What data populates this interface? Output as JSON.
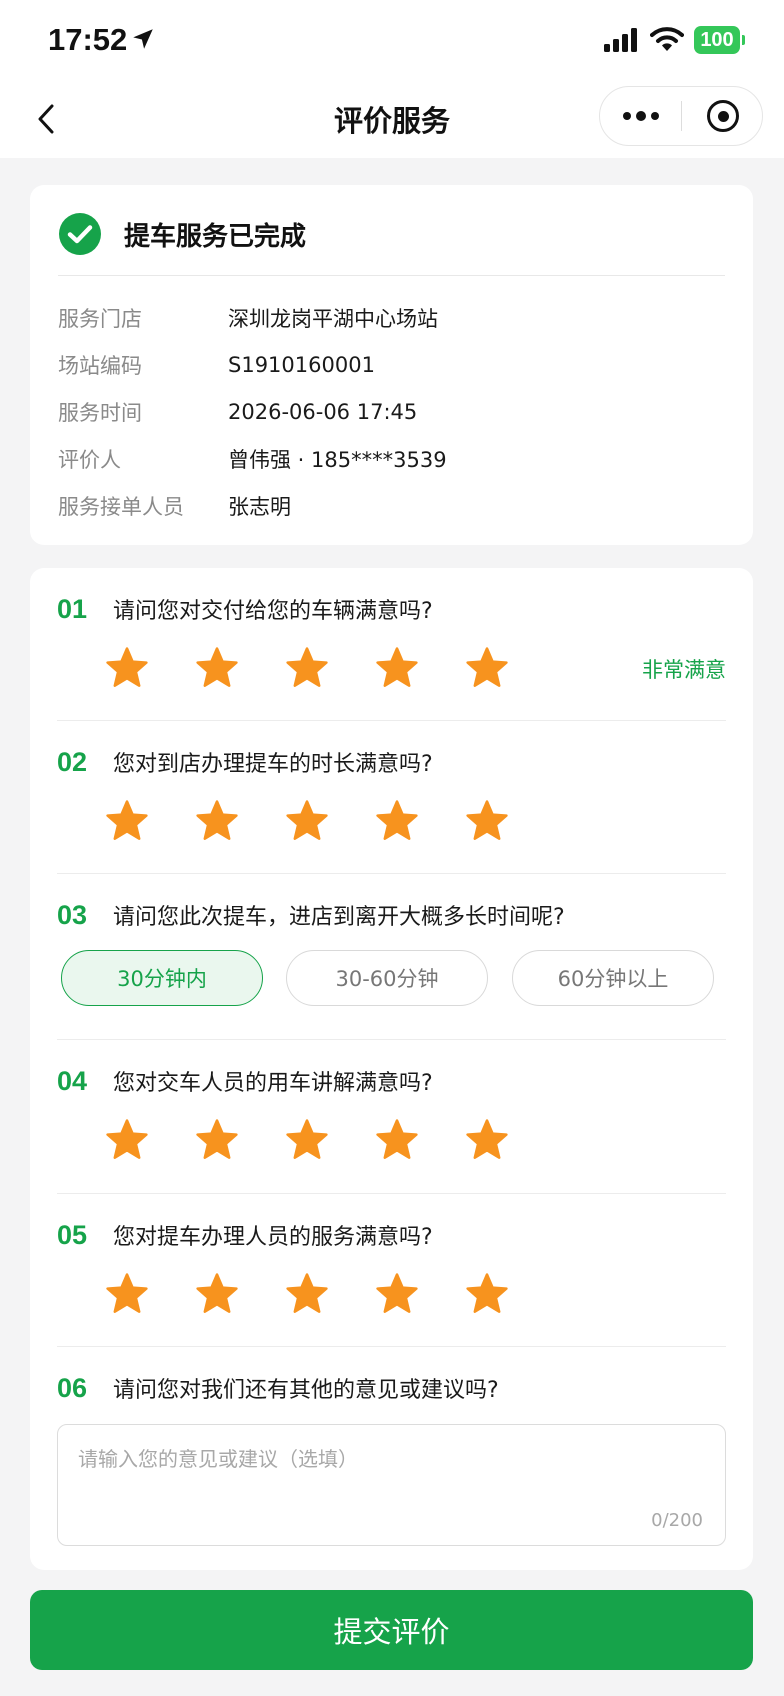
{
  "status_bar": {
    "time": "17:52",
    "battery": "100"
  },
  "nav": {
    "title": "评价服务"
  },
  "info_card": {
    "status_text": "提车服务已完成",
    "rows": [
      {
        "label": "服务门店",
        "value": "深圳龙岗平湖中心场站"
      },
      {
        "label": "场站编码",
        "value": "S1910160001"
      },
      {
        "label": "服务时间",
        "value": "2026-06-06 17:45"
      },
      {
        "label": "评价人",
        "value": "曾伟强 · 185****3539"
      },
      {
        "label": "服务接单人员",
        "value": "张志明"
      }
    ]
  },
  "questions": [
    {
      "num": "01",
      "text": "请问您对交付给您的车辆满意吗?",
      "rating": 5,
      "rating_label": "非常满意"
    },
    {
      "num": "02",
      "text": "您对到店办理提车的时长满意吗?",
      "rating": 5
    },
    {
      "num": "03",
      "text": "请问您此次提车，进店到离开大概多长时间呢?",
      "options": [
        "30分钟内",
        "30-60分钟",
        "60分钟以上"
      ],
      "selected": "30分钟内"
    },
    {
      "num": "04",
      "text": "您对交车人员的用车讲解满意吗?",
      "rating": 5
    },
    {
      "num": "05",
      "text": "您对提车办理人员的服务满意吗?",
      "rating": 5
    },
    {
      "num": "06",
      "text": "请问您对我们还有其他的意见或建议吗?"
    }
  ],
  "feedback": {
    "placeholder": "请输入您的意见或建议（选填）",
    "value": "",
    "counter": "0/200"
  },
  "submit_label": "提交评价",
  "colors": {
    "accent": "#16a34a",
    "star": "#f7931e",
    "background": "#f4f4f5"
  }
}
